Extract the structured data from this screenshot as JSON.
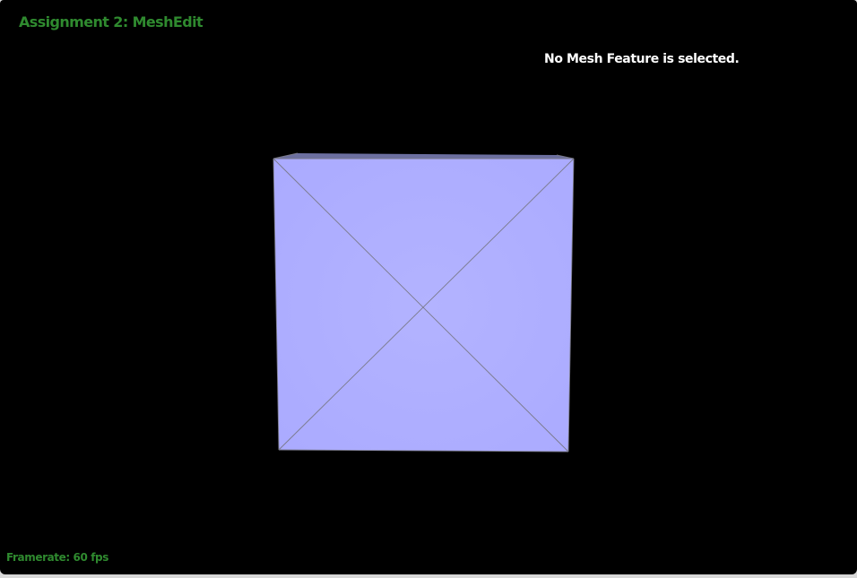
{
  "window": {
    "title": "Assignment 2: MeshEdit"
  },
  "status": {
    "message": "No Mesh Feature is selected."
  },
  "footer": {
    "framerate": "Framerate: 60 fps"
  },
  "mesh": {
    "shape": "cube",
    "face_color": "#b0b0ff",
    "edge_color": "#7a7a8a",
    "background": "#000000"
  },
  "colors": {
    "title_text": "#2f8a2f",
    "status_text": "#ffffff",
    "framerate_text": "#2f8a2f"
  }
}
